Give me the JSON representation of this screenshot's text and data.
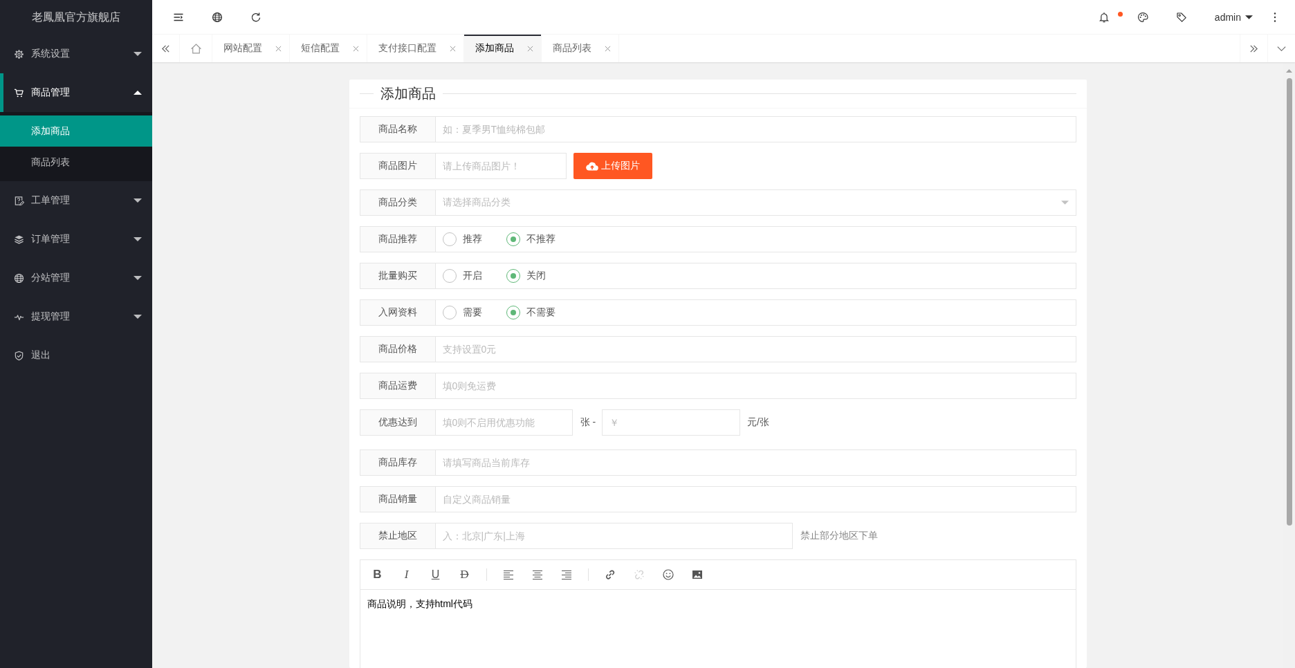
{
  "sidebar": {
    "title": "老鳳凰官方旗舰店",
    "items": [
      {
        "kind": "group",
        "label": "系统设置",
        "expanded": false
      },
      {
        "kind": "group",
        "label": "商品管理",
        "expanded": true,
        "children": [
          {
            "label": "添加商品",
            "selected": true
          },
          {
            "label": "商品列表",
            "selected": false
          }
        ]
      },
      {
        "kind": "group",
        "label": "工单管理",
        "expanded": false
      },
      {
        "kind": "group",
        "label": "订单管理",
        "expanded": false
      },
      {
        "kind": "group",
        "label": "分站管理",
        "expanded": false
      },
      {
        "kind": "group",
        "label": "提现管理",
        "expanded": false
      },
      {
        "kind": "link",
        "label": "退出"
      }
    ]
  },
  "header": {
    "user": "admin",
    "unread": true
  },
  "tabs": [
    {
      "kind": "home",
      "selected": false
    },
    {
      "kind": "page",
      "label": "网站配置",
      "selected": false
    },
    {
      "kind": "page",
      "label": "短信配置",
      "selected": false
    },
    {
      "kind": "page",
      "label": "支付接口配置",
      "selected": false
    },
    {
      "kind": "page",
      "label": "添加商品",
      "selected": true
    },
    {
      "kind": "page",
      "label": "商品列表",
      "selected": false
    }
  ],
  "form": {
    "title": "添加商品",
    "rows": [
      {
        "kind": "text",
        "label": "商品名称",
        "placeholder": "如：夏季男T恤纯棉包邮"
      },
      {
        "kind": "upload",
        "label": "商品图片",
        "placeholder": "请上传商品图片！",
        "button": "上传图片"
      },
      {
        "kind": "select",
        "label": "商品分类",
        "placeholder": "请选择商品分类"
      },
      {
        "kind": "radio",
        "label": "商品推荐",
        "options": [
          {
            "label": "推荐",
            "selected": false
          },
          {
            "label": "不推荐",
            "selected": true
          }
        ]
      },
      {
        "kind": "radio",
        "label": "批量购买",
        "options": [
          {
            "label": "开启",
            "selected": false
          },
          {
            "label": "关闭",
            "selected": true
          }
        ]
      },
      {
        "kind": "radio",
        "label": "入网资料",
        "options": [
          {
            "label": "需要",
            "selected": false
          },
          {
            "label": "不需要",
            "selected": true
          }
        ]
      },
      {
        "kind": "text",
        "label": "商品价格",
        "placeholder": "支持设置0元"
      },
      {
        "kind": "text",
        "label": "商品运费",
        "placeholder": "填0则免运费"
      },
      {
        "kind": "discount",
        "label": "优惠达到",
        "placeholder": "填0则不启用优惠功能",
        "unit": "张 -",
        "placeholder_2": "￥",
        "suffix": "元/张"
      },
      {
        "kind": "text",
        "label": "商品库存",
        "placeholder": "请填写商品当前库存"
      },
      {
        "kind": "text",
        "label": "商品销量",
        "placeholder": "自定义商品销量"
      },
      {
        "kind": "hint",
        "label": "禁止地区",
        "placeholder": "入：北京|广东|上海",
        "hint": "禁止部分地区下单"
      }
    ]
  },
  "editor": {
    "toolbar": [
      {
        "tools": [
          {
            "kind": "bold",
            "text": "B",
            "disabled": false
          },
          {
            "kind": "italic",
            "text": "I",
            "disabled": false
          },
          {
            "kind": "underline",
            "text": "U",
            "disabled": false
          },
          {
            "kind": "strike",
            "text": "D",
            "disabled": false
          }
        ]
      },
      {
        "tools": [
          {
            "kind": "align-left",
            "disabled": false
          },
          {
            "kind": "align-center",
            "disabled": false
          },
          {
            "kind": "align-right",
            "disabled": false
          }
        ]
      },
      {
        "tools": [
          {
            "kind": "link",
            "disabled": false
          },
          {
            "kind": "unlink",
            "disabled": true
          },
          {
            "kind": "face",
            "disabled": false
          },
          {
            "kind": "image",
            "disabled": false
          }
        ]
      }
    ],
    "content": "商品说明，支持html代码"
  }
}
